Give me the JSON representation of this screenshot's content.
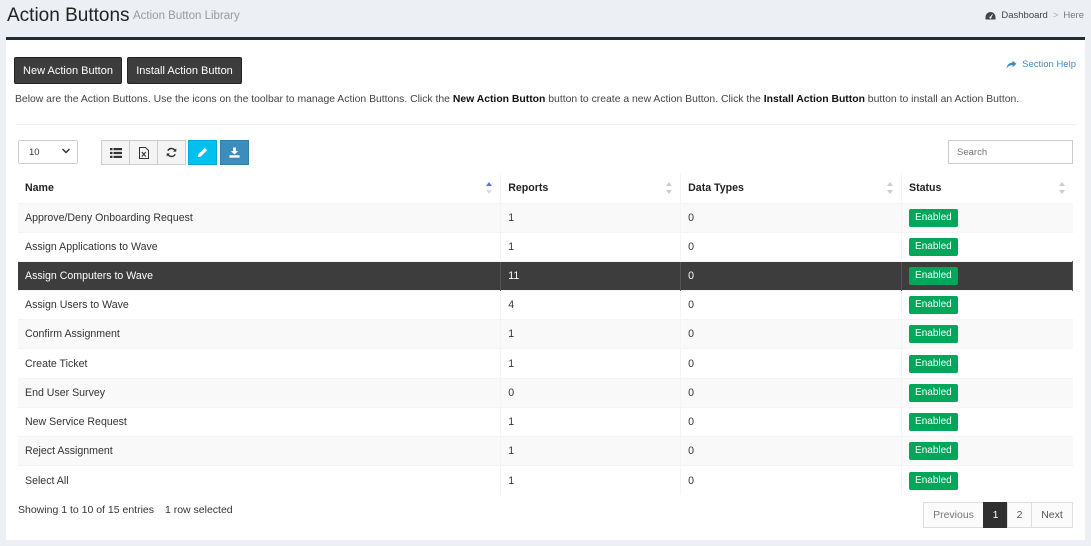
{
  "header": {
    "title": "Action Buttons",
    "subtitle": "Action Button Library",
    "breadcrumb": {
      "dashboard": "Dashboard",
      "separator": ">",
      "current": "Here"
    }
  },
  "actions": {
    "new_label": "New Action Button",
    "install_label": "Install Action Button",
    "section_help": "Section Help"
  },
  "intro": {
    "part1": "Below are the Action Buttons. Use the icons on the toolbar to manage Action Buttons. Click the ",
    "bold1": "New Action Button",
    "part2": " button to create a new Action Button. Click the ",
    "bold2": "Install Action Button",
    "part3": " button to install an Action Button."
  },
  "controls": {
    "page_length": "10",
    "search_placeholder": "Search"
  },
  "table": {
    "columns": [
      "Name",
      "Reports",
      "Data Types",
      "Status"
    ],
    "rows": [
      {
        "name": "Approve/Deny Onboarding Request",
        "reports": "1",
        "data_types": "0",
        "status": "Enabled"
      },
      {
        "name": "Assign Applications to Wave",
        "reports": "1",
        "data_types": "0",
        "status": "Enabled"
      },
      {
        "name": "Assign Computers to Wave",
        "reports": "11",
        "data_types": "0",
        "status": "Enabled"
      },
      {
        "name": "Assign Users to Wave",
        "reports": "4",
        "data_types": "0",
        "status": "Enabled"
      },
      {
        "name": "Confirm Assignment",
        "reports": "1",
        "data_types": "0",
        "status": "Enabled"
      },
      {
        "name": "Create Ticket",
        "reports": "1",
        "data_types": "0",
        "status": "Enabled"
      },
      {
        "name": "End User Survey",
        "reports": "0",
        "data_types": "0",
        "status": "Enabled"
      },
      {
        "name": "New Service Request",
        "reports": "1",
        "data_types": "0",
        "status": "Enabled"
      },
      {
        "name": "Reject Assignment",
        "reports": "1",
        "data_types": "0",
        "status": "Enabled"
      },
      {
        "name": "Select All",
        "reports": "1",
        "data_types": "0",
        "status": "Enabled"
      }
    ]
  },
  "footer": {
    "info": "Showing 1 to 10 of 15 entries",
    "selected": "1 row selected",
    "pagination": {
      "previous": "Previous",
      "page1": "1",
      "page2": "2",
      "next": "Next"
    }
  },
  "colors": {
    "dark_button": "#3d3d3d",
    "enabled_badge": "#00a65a",
    "edit_button": "#00c0ef",
    "download_button": "#3c8dbc",
    "selected_row": "#3d3d3d"
  }
}
